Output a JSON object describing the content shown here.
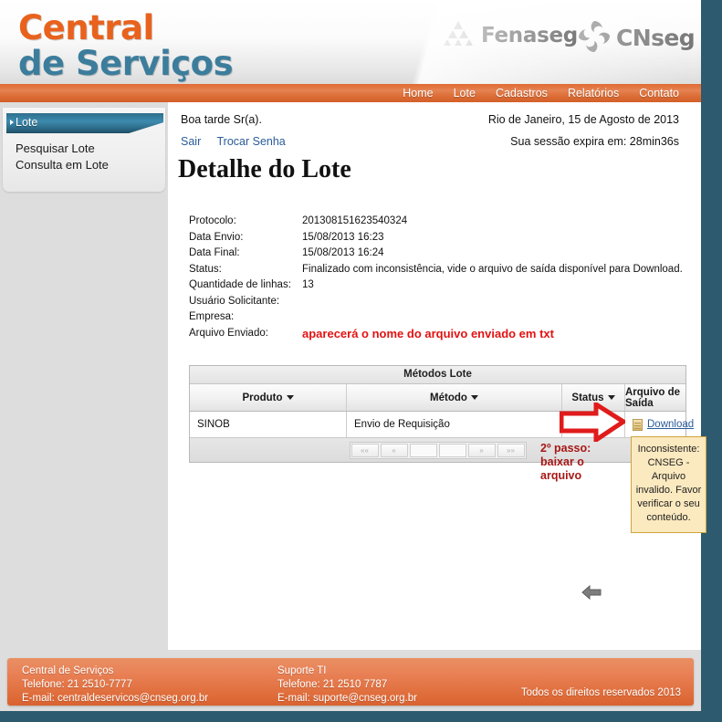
{
  "header": {
    "logo_line1": "Central",
    "logo_line2": "de Serviços",
    "fenaseg_label": "Fenaseg",
    "cnseg_label": "CNseg"
  },
  "nav": {
    "items": [
      {
        "label": "Home"
      },
      {
        "label": "Lote"
      },
      {
        "label": "Cadastros"
      },
      {
        "label": "Relatórios"
      },
      {
        "label": "Contato"
      }
    ]
  },
  "sidebar": {
    "title": "Lote",
    "items": [
      {
        "label": "Pesquisar Lote"
      },
      {
        "label": "Consulta em Lote"
      }
    ]
  },
  "session": {
    "greeting": "Boa tarde Sr(a).",
    "logout_label": "Sair",
    "change_password_label": "Trocar Senha",
    "city_date": "Rio de Janeiro, 15 de Agosto de 2013",
    "expiry": "Sua sessão expira em: 28min36s"
  },
  "main": {
    "page_title": "Detalhe do Lote",
    "details": [
      {
        "label": "Protocolo:",
        "value": "201308151623540324"
      },
      {
        "label": "Data Envio:",
        "value": "15/08/2013 16:23"
      },
      {
        "label": "Data Final:",
        "value": "15/08/2013 16:24"
      },
      {
        "label": "Status:",
        "value": "Finalizado com inconsistência, vide o arquivo de saída disponível para Download."
      },
      {
        "label": "Quantidade de linhas:",
        "value": "13"
      },
      {
        "label": "Usuário Solicitante:",
        "value": ""
      },
      {
        "label": "Empresa:",
        "value": ""
      },
      {
        "label": "Arquivo Enviado:",
        "value": "aparecerá o nome do arquivo enviado em txt"
      }
    ]
  },
  "table": {
    "caption": "Métodos Lote",
    "columns": [
      {
        "label": "Produto",
        "sortable": true
      },
      {
        "label": "Método",
        "sortable": true
      },
      {
        "label": "Status",
        "sortable": true
      },
      {
        "label": "Arquivo de Saída",
        "sortable": false
      }
    ],
    "rows": [
      {
        "produto": "SINOB",
        "metodo": "Envio de Requisição",
        "status_icon": "error-circle-icon",
        "arquivo_icon": "file-icon",
        "arquivo_link": "Download"
      }
    ],
    "pagination": [
      {
        "label": "««"
      },
      {
        "label": "«"
      },
      {
        "label": ""
      },
      {
        "label": ""
      },
      {
        "label": "»"
      },
      {
        "label": "»»"
      }
    ]
  },
  "annotations": {
    "step2": "2º passo: baixar o arquivo",
    "arrow_icon": "red-arrow-right-icon",
    "back_icon": "back-arrow-icon"
  },
  "tooltip": {
    "text": "Inconsistente: CNSEG - Arquivo invalido. Favor verificar o seu conteúdo."
  },
  "footer": {
    "col1": {
      "title": "Central de Serviços",
      "phone": "Telefone: 21 2510-7777",
      "email": "E-mail: centraldeservicos@cnseg.org.br"
    },
    "col2": {
      "title": "Suporte TI",
      "phone": "Telefone: 21 2510 7787",
      "email": "E-mail: suporte@cnseg.org.br"
    },
    "copyright": "Todos os direitos reservados 2013"
  },
  "colors": {
    "orange": "#e06a33",
    "teal": "#2d5a6e",
    "link": "#2a5c9a",
    "red_note": "#e21212",
    "dark_red": "#a81717",
    "tooltip_bg": "#fbe9bf"
  }
}
